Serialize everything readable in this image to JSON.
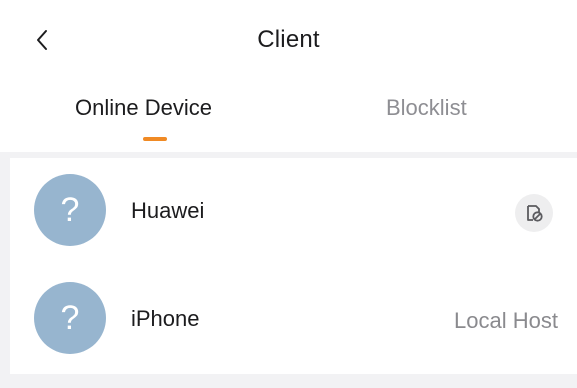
{
  "header": {
    "title": "Client",
    "back_icon": "chevron-left-icon"
  },
  "tabs": [
    {
      "label": "Online Device",
      "active": true
    },
    {
      "label": "Blocklist",
      "active": false
    }
  ],
  "accent_color": "#f08a24",
  "devices": [
    {
      "name": "Huawei",
      "avatar_glyph": "?",
      "action_icon": "block-device-icon"
    },
    {
      "name": "iPhone",
      "avatar_glyph": "?",
      "status": "Local Host"
    }
  ]
}
